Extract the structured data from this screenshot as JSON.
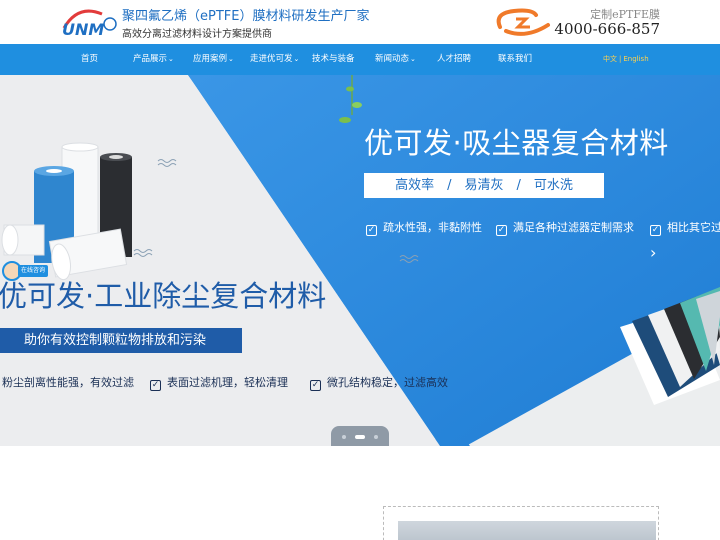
{
  "header": {
    "brand_title": "聚四氟乙烯（ePTFE）膜材料研发生产厂家",
    "brand_subtitle": "高效分离过滤材料设计方案提供商",
    "hotline_label": "定制ePTFE膜",
    "hotline": "4000-666-857"
  },
  "nav": {
    "items": [
      {
        "label": "首页"
      },
      {
        "label": "产品展示"
      },
      {
        "label": "应用案例"
      },
      {
        "label": "走进优可发"
      },
      {
        "label": "技术与装备"
      },
      {
        "label": "新闻动态"
      },
      {
        "label": "人才招聘"
      },
      {
        "label": "联系我们"
      }
    ],
    "lang_zh": "中文",
    "lang_sep": "|",
    "lang_en": "English"
  },
  "banner": {
    "title1": "优可发·吸尘器复合材料",
    "box1": "高效率　/　易清灰　/　可水洗",
    "features1": [
      "疏水性强，非黏附性",
      "满足各种过滤器定制需求",
      "相比其它过"
    ],
    "title2": "优可发·工业除尘复合材料",
    "box2": "助你有效控制颗粒物排放和污染",
    "features2": [
      "粉尘剖离性能强，有效过滤",
      "表面过滤机理，轻松清理",
      "微孔结构稳定，过滤高效"
    ],
    "chat_label": "在线咨询",
    "slide_count": 3,
    "active_slide": 2
  },
  "colors": {
    "nav_bg": "#1f8fe0",
    "brand_blue": "#1f6fc2",
    "banner_blue": "#2a86db",
    "dark_blue_text": "#1f5ca8",
    "lang_yellow": "#ffd24d"
  }
}
